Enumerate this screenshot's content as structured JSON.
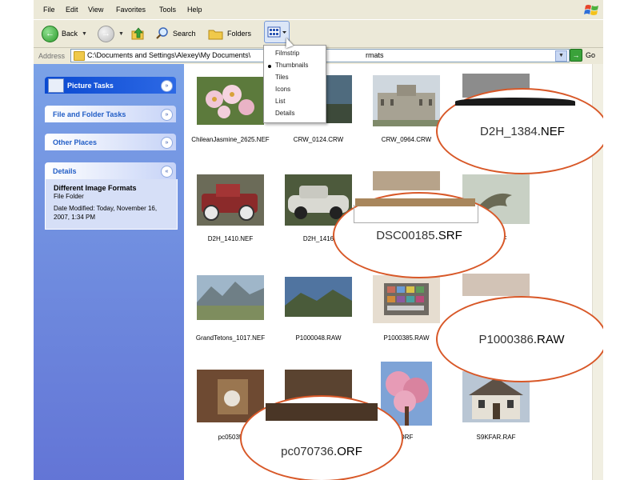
{
  "menubar": {
    "items": [
      "File",
      "Edit",
      "View",
      "Favorites",
      "Tools",
      "Help"
    ]
  },
  "toolbar": {
    "back_label": "Back",
    "search_label": "Search",
    "folders_label": "Folders"
  },
  "address": {
    "label": "Address",
    "path": "C:\\Documents and Settings\\Alexey\\My Documents\\",
    "path_tail": "rmats",
    "go_label": "Go"
  },
  "view_menu": {
    "items": [
      "Filmstrip",
      "Thumbnails",
      "Tiles",
      "Icons",
      "List",
      "Details"
    ],
    "selected": "Thumbnails"
  },
  "left_panel": {
    "picture_tasks": "Picture Tasks",
    "file_folder_tasks": "File and Folder Tasks",
    "other_places": "Other Places",
    "details": "Details",
    "folder_name": "Different Image Formats",
    "folder_type": "File Folder",
    "date_modified": "Date Modified: Today, November 16, 2007, 1:34 PM"
  },
  "files": [
    {
      "name": "ChileanJasmine_2625.NEF"
    },
    {
      "name": "CRW_0124.CRW"
    },
    {
      "name": "CRW_0964.CRW"
    },
    {
      "name": ""
    },
    {
      "name": "D2H_1410.NEF"
    },
    {
      "name": "D2H_1416"
    },
    {
      "name": ""
    },
    {
      "name": "26.NEF"
    },
    {
      "name": "GrandTetons_1017.NEF"
    },
    {
      "name": "P1000048.RAW"
    },
    {
      "name": "P1000385.RAW"
    },
    {
      "name": ""
    },
    {
      "name": "pc05035"
    },
    {
      "name": ""
    },
    {
      "name": "ORF"
    },
    {
      "name": "S9KFAR.RAF"
    }
  ],
  "callouts": [
    {
      "stem": "D2H_1384",
      "ext": ".NEF"
    },
    {
      "stem": "DSC00185",
      "ext": ".SRF"
    },
    {
      "stem": "P1000386",
      "ext": ".RAW"
    },
    {
      "stem": "pc070736",
      "ext": ".ORF"
    }
  ],
  "colors": {
    "callout_border": "#d85828",
    "task_header": "#0a49d1",
    "panel_bg": "#6f8ddf"
  }
}
